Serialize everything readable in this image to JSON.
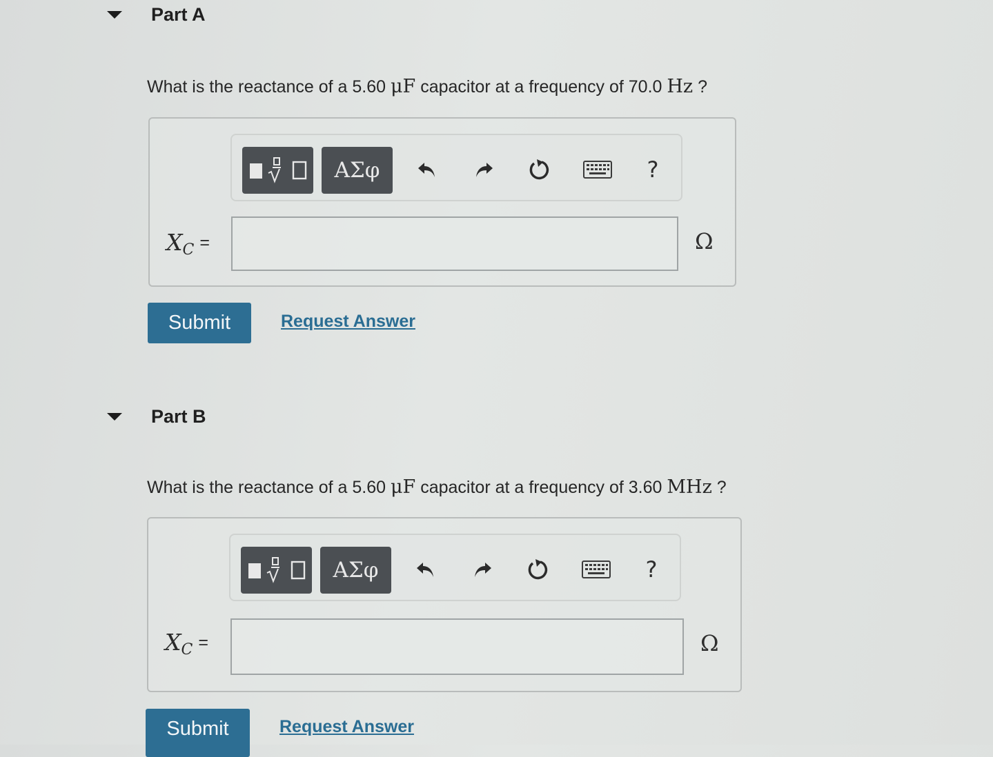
{
  "parts": [
    {
      "title": "Part A",
      "question": {
        "prefix": "What is the reactance of a 5.60 ",
        "unit1": "μF",
        "middle": " capacitor at a frequency of 70.0 ",
        "unit2": "Hz",
        "suffix": " ?"
      },
      "toolbar": {
        "greek_label": "ΑΣφ",
        "help_label": "?"
      },
      "variable": "X",
      "variable_sub": "C",
      "equals": "=",
      "input_value": "",
      "unit": "Ω",
      "submit_label": "Submit",
      "request_label": "Request Answer"
    },
    {
      "title": "Part B",
      "question": {
        "prefix": "What is the reactance of a 5.60 ",
        "unit1": "μF",
        "middle": " capacitor at a frequency of 3.60 ",
        "unit2": "MHz",
        "suffix": " ?"
      },
      "toolbar": {
        "greek_label": "ΑΣφ",
        "help_label": "?"
      },
      "variable": "X",
      "variable_sub": "C",
      "equals": "=",
      "input_value": "",
      "unit": "Ω",
      "submit_label": "Submit",
      "request_label": "Request Answer"
    }
  ],
  "icons": {
    "collapse": "caret-down-icon",
    "template": "templates-icon",
    "undo": "undo-icon",
    "redo": "redo-icon",
    "reset": "reset-icon",
    "keyboard": "keyboard-icon"
  },
  "colors": {
    "submit_bg": "#2d6e93",
    "link": "#2a6d93",
    "toolbar_dark": "#4b4f53"
  }
}
